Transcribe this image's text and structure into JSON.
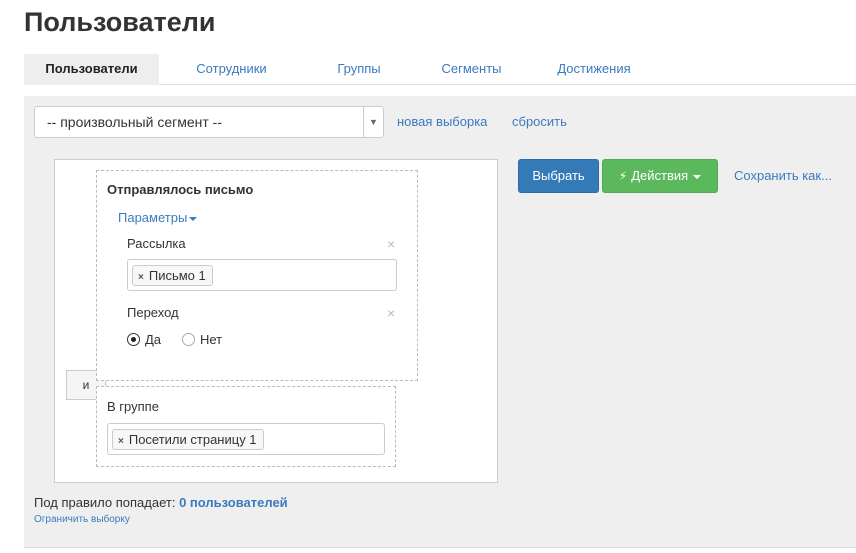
{
  "page": {
    "title": "Пользователи"
  },
  "tabs": [
    {
      "label": "Пользователи",
      "active": true
    },
    {
      "label": "Сотрудники",
      "active": false
    },
    {
      "label": "Группы",
      "active": false
    },
    {
      "label": "Сегменты",
      "active": false
    },
    {
      "label": "Достижения",
      "active": false
    }
  ],
  "segment": {
    "selected": "-- произвольный сегмент --",
    "arrow_icon": "triangle-down-icon",
    "new_selection_label": "новая выборка",
    "reset_label": "сбросить"
  },
  "rules": {
    "and_label": "и",
    "email_rule": {
      "title": "Отправлялось письмо",
      "params_label": "Параметры",
      "mailing": {
        "label": "Рассылка",
        "tags": [
          "Письмо 1"
        ]
      },
      "transition": {
        "label": "Переход",
        "options": [
          {
            "label": "Да",
            "checked": true
          },
          {
            "label": "Нет",
            "checked": false
          }
        ]
      }
    },
    "group_rule": {
      "title": "В группе",
      "tags": [
        "Посетили страницу 1"
      ]
    }
  },
  "actions": {
    "select_label": "Выбрать",
    "actions_label": "Действия",
    "actions_icon": "lightning-icon",
    "save_label": "Сохранить как..."
  },
  "summary": {
    "prefix": "Под правило попадает:",
    "count": "0 пользователей",
    "limit_label": "Ограничить выборку"
  },
  "colors": {
    "link": "#3a7bbf",
    "primary": "#337ab7",
    "success": "#5cb85c",
    "panel_bg": "#efefef"
  }
}
